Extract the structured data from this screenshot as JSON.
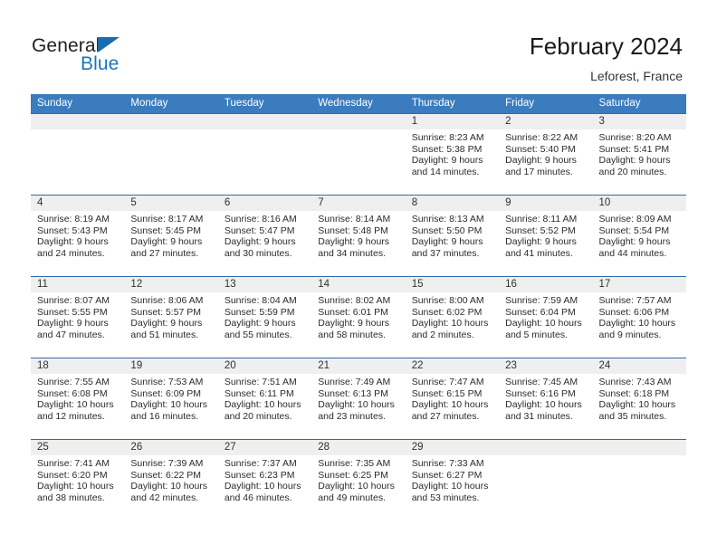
{
  "brand": {
    "name_part1": "General",
    "name_part2": "Blue",
    "logo_icon": "triangle-logo-icon",
    "accent_color": "#1a74bb"
  },
  "header": {
    "title": "February 2024",
    "location": "Leforest, France"
  },
  "theme": {
    "header_blue": "#3a7cbe",
    "rule_blue": "#2f6da8",
    "number_band": "#efefef"
  },
  "calendar": {
    "weekday_headers": [
      "Sunday",
      "Monday",
      "Tuesday",
      "Wednesday",
      "Thursday",
      "Friday",
      "Saturday"
    ],
    "weeks": [
      {
        "days": [
          {
            "num": "",
            "sunrise": "",
            "sunset": "",
            "daylight1": "",
            "daylight2": ""
          },
          {
            "num": "",
            "sunrise": "",
            "sunset": "",
            "daylight1": "",
            "daylight2": ""
          },
          {
            "num": "",
            "sunrise": "",
            "sunset": "",
            "daylight1": "",
            "daylight2": ""
          },
          {
            "num": "",
            "sunrise": "",
            "sunset": "",
            "daylight1": "",
            "daylight2": ""
          },
          {
            "num": "1",
            "sunrise": "Sunrise: 8:23 AM",
            "sunset": "Sunset: 5:38 PM",
            "daylight1": "Daylight: 9 hours",
            "daylight2": "and 14 minutes."
          },
          {
            "num": "2",
            "sunrise": "Sunrise: 8:22 AM",
            "sunset": "Sunset: 5:40 PM",
            "daylight1": "Daylight: 9 hours",
            "daylight2": "and 17 minutes."
          },
          {
            "num": "3",
            "sunrise": "Sunrise: 8:20 AM",
            "sunset": "Sunset: 5:41 PM",
            "daylight1": "Daylight: 9 hours",
            "daylight2": "and 20 minutes."
          }
        ]
      },
      {
        "days": [
          {
            "num": "4",
            "sunrise": "Sunrise: 8:19 AM",
            "sunset": "Sunset: 5:43 PM",
            "daylight1": "Daylight: 9 hours",
            "daylight2": "and 24 minutes."
          },
          {
            "num": "5",
            "sunrise": "Sunrise: 8:17 AM",
            "sunset": "Sunset: 5:45 PM",
            "daylight1": "Daylight: 9 hours",
            "daylight2": "and 27 minutes."
          },
          {
            "num": "6",
            "sunrise": "Sunrise: 8:16 AM",
            "sunset": "Sunset: 5:47 PM",
            "daylight1": "Daylight: 9 hours",
            "daylight2": "and 30 minutes."
          },
          {
            "num": "7",
            "sunrise": "Sunrise: 8:14 AM",
            "sunset": "Sunset: 5:48 PM",
            "daylight1": "Daylight: 9 hours",
            "daylight2": "and 34 minutes."
          },
          {
            "num": "8",
            "sunrise": "Sunrise: 8:13 AM",
            "sunset": "Sunset: 5:50 PM",
            "daylight1": "Daylight: 9 hours",
            "daylight2": "and 37 minutes."
          },
          {
            "num": "9",
            "sunrise": "Sunrise: 8:11 AM",
            "sunset": "Sunset: 5:52 PM",
            "daylight1": "Daylight: 9 hours",
            "daylight2": "and 41 minutes."
          },
          {
            "num": "10",
            "sunrise": "Sunrise: 8:09 AM",
            "sunset": "Sunset: 5:54 PM",
            "daylight1": "Daylight: 9 hours",
            "daylight2": "and 44 minutes."
          }
        ]
      },
      {
        "days": [
          {
            "num": "11",
            "sunrise": "Sunrise: 8:07 AM",
            "sunset": "Sunset: 5:55 PM",
            "daylight1": "Daylight: 9 hours",
            "daylight2": "and 47 minutes."
          },
          {
            "num": "12",
            "sunrise": "Sunrise: 8:06 AM",
            "sunset": "Sunset: 5:57 PM",
            "daylight1": "Daylight: 9 hours",
            "daylight2": "and 51 minutes."
          },
          {
            "num": "13",
            "sunrise": "Sunrise: 8:04 AM",
            "sunset": "Sunset: 5:59 PM",
            "daylight1": "Daylight: 9 hours",
            "daylight2": "and 55 minutes."
          },
          {
            "num": "14",
            "sunrise": "Sunrise: 8:02 AM",
            "sunset": "Sunset: 6:01 PM",
            "daylight1": "Daylight: 9 hours",
            "daylight2": "and 58 minutes."
          },
          {
            "num": "15",
            "sunrise": "Sunrise: 8:00 AM",
            "sunset": "Sunset: 6:02 PM",
            "daylight1": "Daylight: 10 hours",
            "daylight2": "and 2 minutes."
          },
          {
            "num": "16",
            "sunrise": "Sunrise: 7:59 AM",
            "sunset": "Sunset: 6:04 PM",
            "daylight1": "Daylight: 10 hours",
            "daylight2": "and 5 minutes."
          },
          {
            "num": "17",
            "sunrise": "Sunrise: 7:57 AM",
            "sunset": "Sunset: 6:06 PM",
            "daylight1": "Daylight: 10 hours",
            "daylight2": "and 9 minutes."
          }
        ]
      },
      {
        "days": [
          {
            "num": "18",
            "sunrise": "Sunrise: 7:55 AM",
            "sunset": "Sunset: 6:08 PM",
            "daylight1": "Daylight: 10 hours",
            "daylight2": "and 12 minutes."
          },
          {
            "num": "19",
            "sunrise": "Sunrise: 7:53 AM",
            "sunset": "Sunset: 6:09 PM",
            "daylight1": "Daylight: 10 hours",
            "daylight2": "and 16 minutes."
          },
          {
            "num": "20",
            "sunrise": "Sunrise: 7:51 AM",
            "sunset": "Sunset: 6:11 PM",
            "daylight1": "Daylight: 10 hours",
            "daylight2": "and 20 minutes."
          },
          {
            "num": "21",
            "sunrise": "Sunrise: 7:49 AM",
            "sunset": "Sunset: 6:13 PM",
            "daylight1": "Daylight: 10 hours",
            "daylight2": "and 23 minutes."
          },
          {
            "num": "22",
            "sunrise": "Sunrise: 7:47 AM",
            "sunset": "Sunset: 6:15 PM",
            "daylight1": "Daylight: 10 hours",
            "daylight2": "and 27 minutes."
          },
          {
            "num": "23",
            "sunrise": "Sunrise: 7:45 AM",
            "sunset": "Sunset: 6:16 PM",
            "daylight1": "Daylight: 10 hours",
            "daylight2": "and 31 minutes."
          },
          {
            "num": "24",
            "sunrise": "Sunrise: 7:43 AM",
            "sunset": "Sunset: 6:18 PM",
            "daylight1": "Daylight: 10 hours",
            "daylight2": "and 35 minutes."
          }
        ]
      },
      {
        "days": [
          {
            "num": "25",
            "sunrise": "Sunrise: 7:41 AM",
            "sunset": "Sunset: 6:20 PM",
            "daylight1": "Daylight: 10 hours",
            "daylight2": "and 38 minutes."
          },
          {
            "num": "26",
            "sunrise": "Sunrise: 7:39 AM",
            "sunset": "Sunset: 6:22 PM",
            "daylight1": "Daylight: 10 hours",
            "daylight2": "and 42 minutes."
          },
          {
            "num": "27",
            "sunrise": "Sunrise: 7:37 AM",
            "sunset": "Sunset: 6:23 PM",
            "daylight1": "Daylight: 10 hours",
            "daylight2": "and 46 minutes."
          },
          {
            "num": "28",
            "sunrise": "Sunrise: 7:35 AM",
            "sunset": "Sunset: 6:25 PM",
            "daylight1": "Daylight: 10 hours",
            "daylight2": "and 49 minutes."
          },
          {
            "num": "29",
            "sunrise": "Sunrise: 7:33 AM",
            "sunset": "Sunset: 6:27 PM",
            "daylight1": "Daylight: 10 hours",
            "daylight2": "and 53 minutes."
          },
          {
            "num": "",
            "sunrise": "",
            "sunset": "",
            "daylight1": "",
            "daylight2": ""
          },
          {
            "num": "",
            "sunrise": "",
            "sunset": "",
            "daylight1": "",
            "daylight2": ""
          }
        ]
      }
    ]
  }
}
